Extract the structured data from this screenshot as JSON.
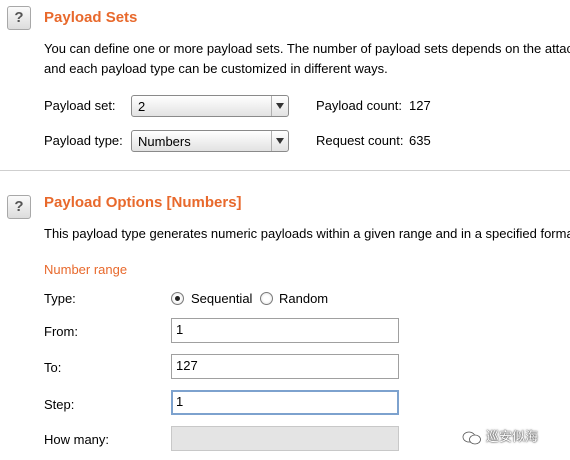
{
  "payload_sets": {
    "help_icon": "?",
    "title": "Payload Sets",
    "description_line1": "You can define one or more payload sets. The number of payload sets depends on the attac",
    "description_line2": "and each payload type can be customized in different ways.",
    "payload_set_label": "Payload set:",
    "payload_set_value": "2",
    "payload_type_label": "Payload type:",
    "payload_type_value": "Numbers",
    "payload_count_label": "Payload count:",
    "payload_count_value": "127",
    "request_count_label": "Request count:",
    "request_count_value": "635"
  },
  "payload_options": {
    "help_icon": "?",
    "title": "Payload Options [Numbers]",
    "description": "This payload type generates numeric payloads within a given range and in a specified forma",
    "number_range_label": "Number range",
    "type_label": "Type:",
    "type_options": [
      "Sequential",
      "Random"
    ],
    "type_selected": "Sequential",
    "from_label": "From:",
    "from_value": "1",
    "to_label": "To:",
    "to_value": "127",
    "step_label": "Step:",
    "step_value": "1",
    "how_many_label": "How many:",
    "how_many_value": ""
  },
  "watermark": {
    "text": "巡安似海",
    "icon": "wechat-icon"
  },
  "colors": {
    "accent": "#e8692c",
    "focus_border": "#7da2ce"
  }
}
